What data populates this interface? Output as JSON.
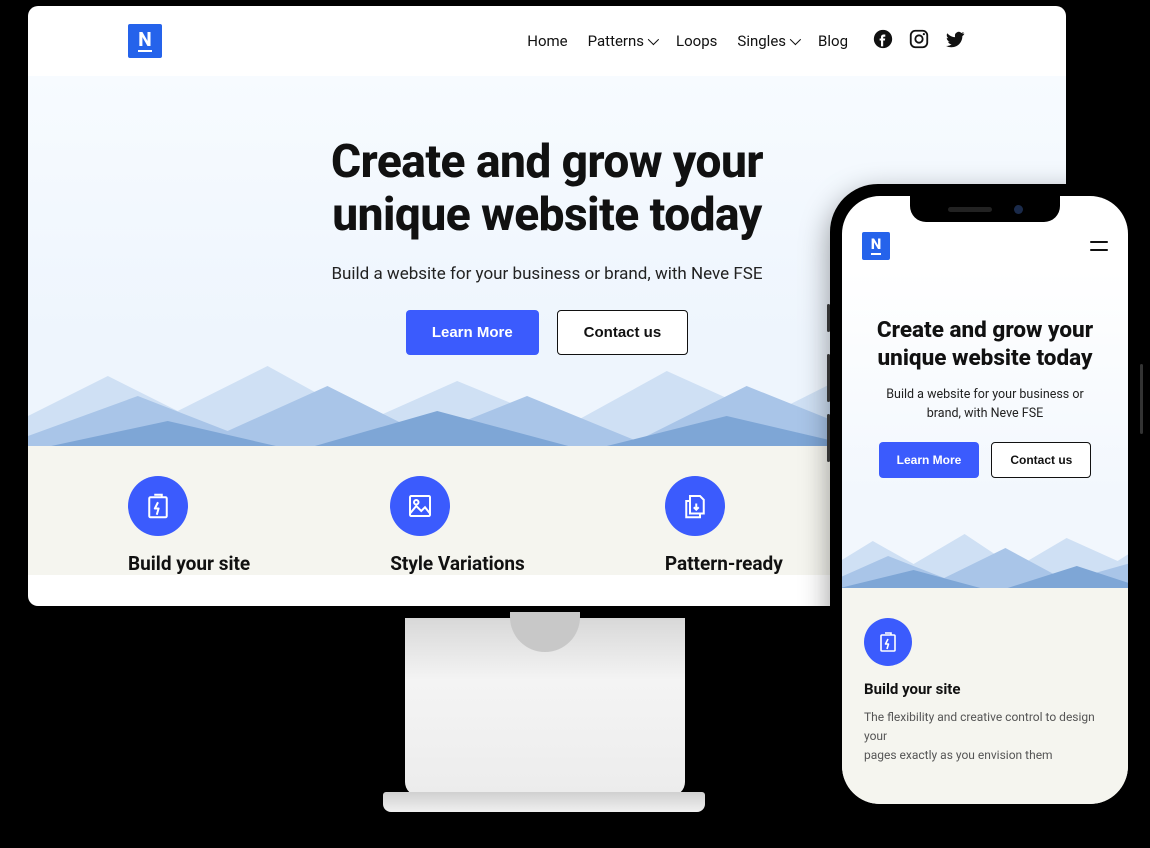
{
  "logo_letter": "N",
  "nav": {
    "items": [
      {
        "label": "Home",
        "dropdown": false
      },
      {
        "label": "Patterns",
        "dropdown": true
      },
      {
        "label": "Loops",
        "dropdown": false
      },
      {
        "label": "Singles",
        "dropdown": true
      },
      {
        "label": "Blog",
        "dropdown": false
      }
    ],
    "social": [
      "facebook",
      "instagram",
      "twitter"
    ]
  },
  "hero": {
    "title_line1": "Create and grow your",
    "title_line2": "unique website today",
    "subtitle": "Build a website for your business or brand, with Neve FSE",
    "cta_primary": "Learn More",
    "cta_secondary": "Contact us"
  },
  "features": [
    {
      "icon": "battery-bolt",
      "title": "Build your site"
    },
    {
      "icon": "image",
      "title": "Style Variations"
    },
    {
      "icon": "files-download",
      "title": "Pattern-ready"
    }
  ],
  "mobile": {
    "hero": {
      "title_line1": "Create and grow your",
      "title_line2": "unique website today",
      "subtitle_line1": "Build a website for your business or",
      "subtitle_line2": "brand, with Neve FSE",
      "cta_primary": "Learn More",
      "cta_secondary": "Contact us"
    },
    "feature": {
      "icon": "battery-bolt",
      "title": "Build your site",
      "body_line1": "The flexibility and creative control to design your",
      "body_line2": "pages exactly as you envision them"
    }
  },
  "colors": {
    "accent": "#3b5bfd",
    "logo_bg": "#2563eb",
    "section_bg": "#f5f5ef"
  }
}
